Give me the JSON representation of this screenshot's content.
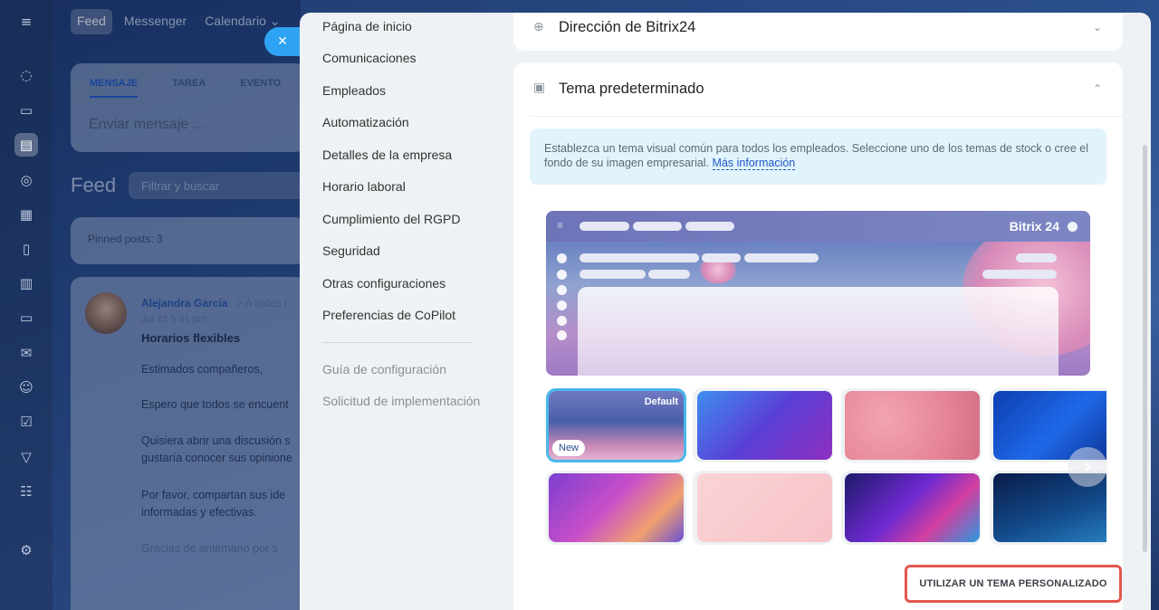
{
  "background_app": {
    "top_tabs": [
      "Feed",
      "Messenger",
      "Calendario ⌄"
    ],
    "composer_tabs": [
      "MENSAJE",
      "TAREA",
      "EVENTO"
    ],
    "composer_placeholder": "Enviar mensaje ...",
    "feed_title": "Feed",
    "feed_filter_placeholder": "Filtrar y buscar",
    "pinned": "Pinned posts: 3",
    "post": {
      "author": "Alejandra García",
      "to": "> A todos l",
      "date": "Jul 23 5:01 pm",
      "title": "Horarios flexibles",
      "lines": [
        "Estimados compañeros,",
        "Espero que todos se encuent",
        "Quisiera abrir una discusión s",
        "gustaría conocer sus opinione",
        "Por favor, compartan sus ide",
        "informadas y efectivas.",
        "Gracias de antemano por s"
      ]
    }
  },
  "settings_nav": {
    "items": [
      "Página de inicio",
      "Comunicaciones",
      "Empleados",
      "Automatización",
      "Detalles de la empresa",
      "Horario laboral",
      "Cumplimiento del RGPD",
      "Seguridad",
      "Otras configuraciones",
      "Preferencias de CoPilot"
    ],
    "secondary": [
      "Guía de configuración",
      "Solicitud de implementación"
    ]
  },
  "address_section": {
    "title": "Dirección de Bitrix24"
  },
  "theme_section": {
    "title": "Tema predeterminado",
    "info_text": "Establezca un tema visual común para todos los empleados. Seleccione uno de los temas de stock o cree el fondo de su imagen empresarial.",
    "info_link": "Más información",
    "preview_brand": "Bitrix 24",
    "default_badge": "Default",
    "new_badge": "New",
    "custom_button": "UTILIZAR UN TEMA PERSONALIZADO"
  }
}
